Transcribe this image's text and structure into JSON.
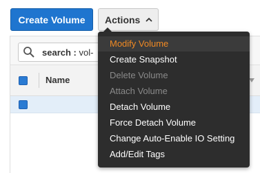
{
  "toolbar": {
    "create_volume_label": "Create Volume",
    "actions_label": "Actions"
  },
  "search": {
    "key": "search :",
    "value": "vol-"
  },
  "table": {
    "columns": [
      "Name"
    ]
  },
  "actions_menu": {
    "items": [
      {
        "label": "Modify Volume",
        "state": "highlighted"
      },
      {
        "label": "Create Snapshot",
        "state": "enabled"
      },
      {
        "label": "Delete Volume",
        "state": "disabled"
      },
      {
        "label": "Attach Volume",
        "state": "disabled"
      },
      {
        "label": "Detach Volume",
        "state": "enabled"
      },
      {
        "label": "Force Detach Volume",
        "state": "enabled"
      },
      {
        "label": "Change Auto-Enable IO Setting",
        "state": "enabled"
      },
      {
        "label": "Add/Edit Tags",
        "state": "enabled"
      }
    ]
  },
  "colors": {
    "primary": "#1f75cf",
    "menu_bg": "#2d2d2d",
    "menu_highlight_text": "#f08a24",
    "menu_disabled_text": "#8a8a8a",
    "selected_row": "#e3eef9"
  }
}
